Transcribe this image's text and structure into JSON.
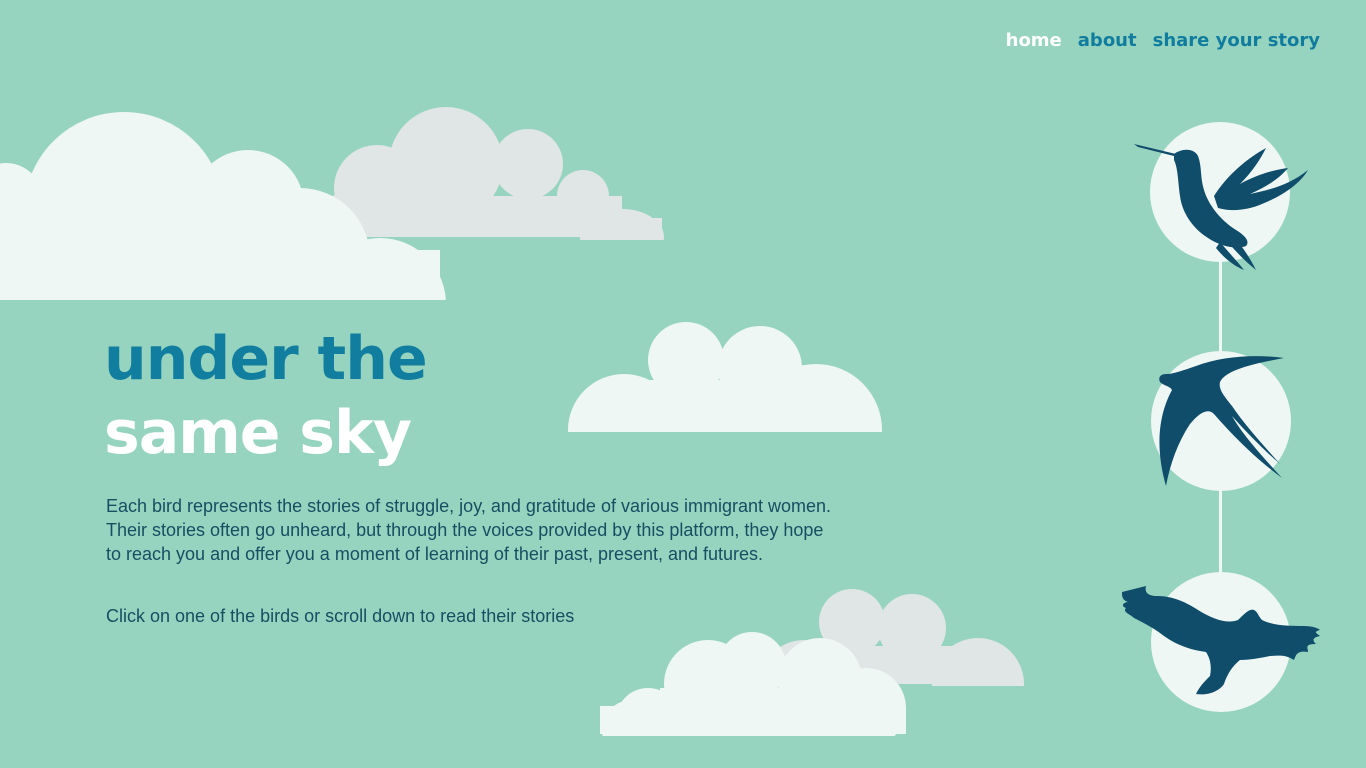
{
  "nav": {
    "items": [
      {
        "label": "home",
        "active": true
      },
      {
        "label": "about",
        "active": false
      },
      {
        "label": "share your story",
        "active": false
      }
    ]
  },
  "hero": {
    "title_line1": "under the",
    "title_line2": "same sky",
    "description": "Each bird represents the stories of struggle, joy, and gratitude of various immigrant women. Their stories often go unheard, but through the voices provided by this platform, they hope to reach you and offer you a moment of learning of their past, present, and futures.",
    "call_to_action": "Click on one of the birds or scroll down to read their stories"
  },
  "birds": [
    {
      "icon": "hummingbird-icon"
    },
    {
      "icon": "swallow-icon"
    },
    {
      "icon": "eagle-icon"
    }
  ],
  "colors": {
    "background": "#97d4bf",
    "title_accent": "#127e9f",
    "nav_link": "#117d9e",
    "body_text": "#184d62",
    "bird": "#0f4d6b",
    "cloud_white": "#eef7f4",
    "cloud_grey": "#dfe6e5"
  }
}
